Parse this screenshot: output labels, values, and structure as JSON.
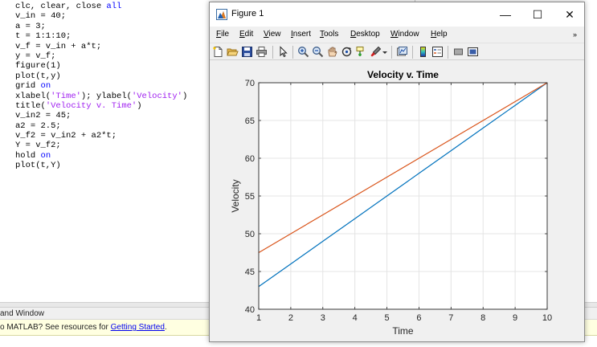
{
  "editor": {
    "lines": [
      [
        {
          "t": "clc, clear, close ",
          "c": ""
        },
        {
          "t": "all",
          "c": "kw"
        }
      ],
      [
        {
          "t": "v_in = 40;",
          "c": ""
        }
      ],
      [
        {
          "t": "a = 3;",
          "c": ""
        }
      ],
      [
        {
          "t": "t = 1:1:10;",
          "c": ""
        }
      ],
      [
        {
          "t": "v_f = v_in + a*t;",
          "c": ""
        }
      ],
      [
        {
          "t": "y = v_f;",
          "c": ""
        }
      ],
      [
        {
          "t": "figure(1)",
          "c": ""
        }
      ],
      [
        {
          "t": "plot(t,y)",
          "c": ""
        }
      ],
      [
        {
          "t": "grid ",
          "c": ""
        },
        {
          "t": "on",
          "c": "kw"
        }
      ],
      [
        {
          "t": "xlabel(",
          "c": ""
        },
        {
          "t": "'Time'",
          "c": "str"
        },
        {
          "t": "); ylabel(",
          "c": ""
        },
        {
          "t": "'Velocity'",
          "c": "str"
        },
        {
          "t": ")",
          "c": ""
        }
      ],
      [
        {
          "t": "title(",
          "c": ""
        },
        {
          "t": "'Velocity v. Time'",
          "c": "str"
        },
        {
          "t": ")",
          "c": ""
        }
      ],
      [
        {
          "t": "v_in2 = 45;",
          "c": ""
        }
      ],
      [
        {
          "t": "a2 = 2.5;",
          "c": ""
        }
      ],
      [
        {
          "t": "v_f2 = v_in2 + a2*t;",
          "c": ""
        }
      ],
      [
        {
          "t": "Y = v_f2;",
          "c": ""
        }
      ],
      [
        {
          "t": "hold ",
          "c": ""
        },
        {
          "t": "on",
          "c": "kw"
        }
      ],
      [
        {
          "t": "plot(t,Y)",
          "c": ""
        }
      ]
    ]
  },
  "command_window": {
    "header": "and Window",
    "banner_prefix": "o MATLAB? See resources for ",
    "banner_link": "Getting Started",
    "banner_suffix": "."
  },
  "figure": {
    "title": "Figure 1",
    "minimize": "—",
    "maximize": "☐",
    "close": "✕",
    "menus": [
      {
        "label": "File",
        "u": "F",
        "rest": "ile"
      },
      {
        "label": "Edit",
        "u": "E",
        "rest": "dit"
      },
      {
        "label": "View",
        "u": "V",
        "rest": "iew"
      },
      {
        "label": "Insert",
        "u": "I",
        "rest": "nsert"
      },
      {
        "label": "Tools",
        "u": "T",
        "rest": "ools"
      },
      {
        "label": "Desktop",
        "u": "D",
        "rest": "esktop"
      },
      {
        "label": "Window",
        "u": "W",
        "rest": "indow"
      },
      {
        "label": "Help",
        "u": "H",
        "rest": "elp"
      }
    ],
    "menu_overflow": "»",
    "toolbar_icons": [
      "new-figure-icon",
      "open-file-icon",
      "save-icon",
      "print-icon",
      "pointer-icon",
      "zoom-in-icon",
      "zoom-out-icon",
      "pan-icon",
      "rotate-3d-icon",
      "data-cursor-icon",
      "brush-icon",
      "dropdown-arrow-icon",
      "link-plot-icon",
      "colorbar-icon",
      "legend-icon",
      "hide-plot-tools-icon",
      "show-plot-tools-icon"
    ]
  },
  "chart_data": {
    "type": "line",
    "title": "Velocity v. Time",
    "xlabel": "Time",
    "ylabel": "Velocity",
    "xlim": [
      1,
      10
    ],
    "ylim": [
      40,
      70
    ],
    "xticks": [
      1,
      2,
      3,
      4,
      5,
      6,
      7,
      8,
      9,
      10
    ],
    "yticks": [
      40,
      45,
      50,
      55,
      60,
      65,
      70
    ],
    "grid": true,
    "x": [
      1,
      2,
      3,
      4,
      5,
      6,
      7,
      8,
      9,
      10
    ],
    "series": [
      {
        "values": [
          43,
          46,
          49,
          52,
          55,
          58,
          61,
          64,
          67,
          70
        ],
        "color": "#0072bd"
      },
      {
        "values": [
          47.5,
          50,
          52.5,
          55,
          57.5,
          60,
          62.5,
          65,
          67.5,
          70
        ],
        "color": "#d95319"
      }
    ]
  }
}
